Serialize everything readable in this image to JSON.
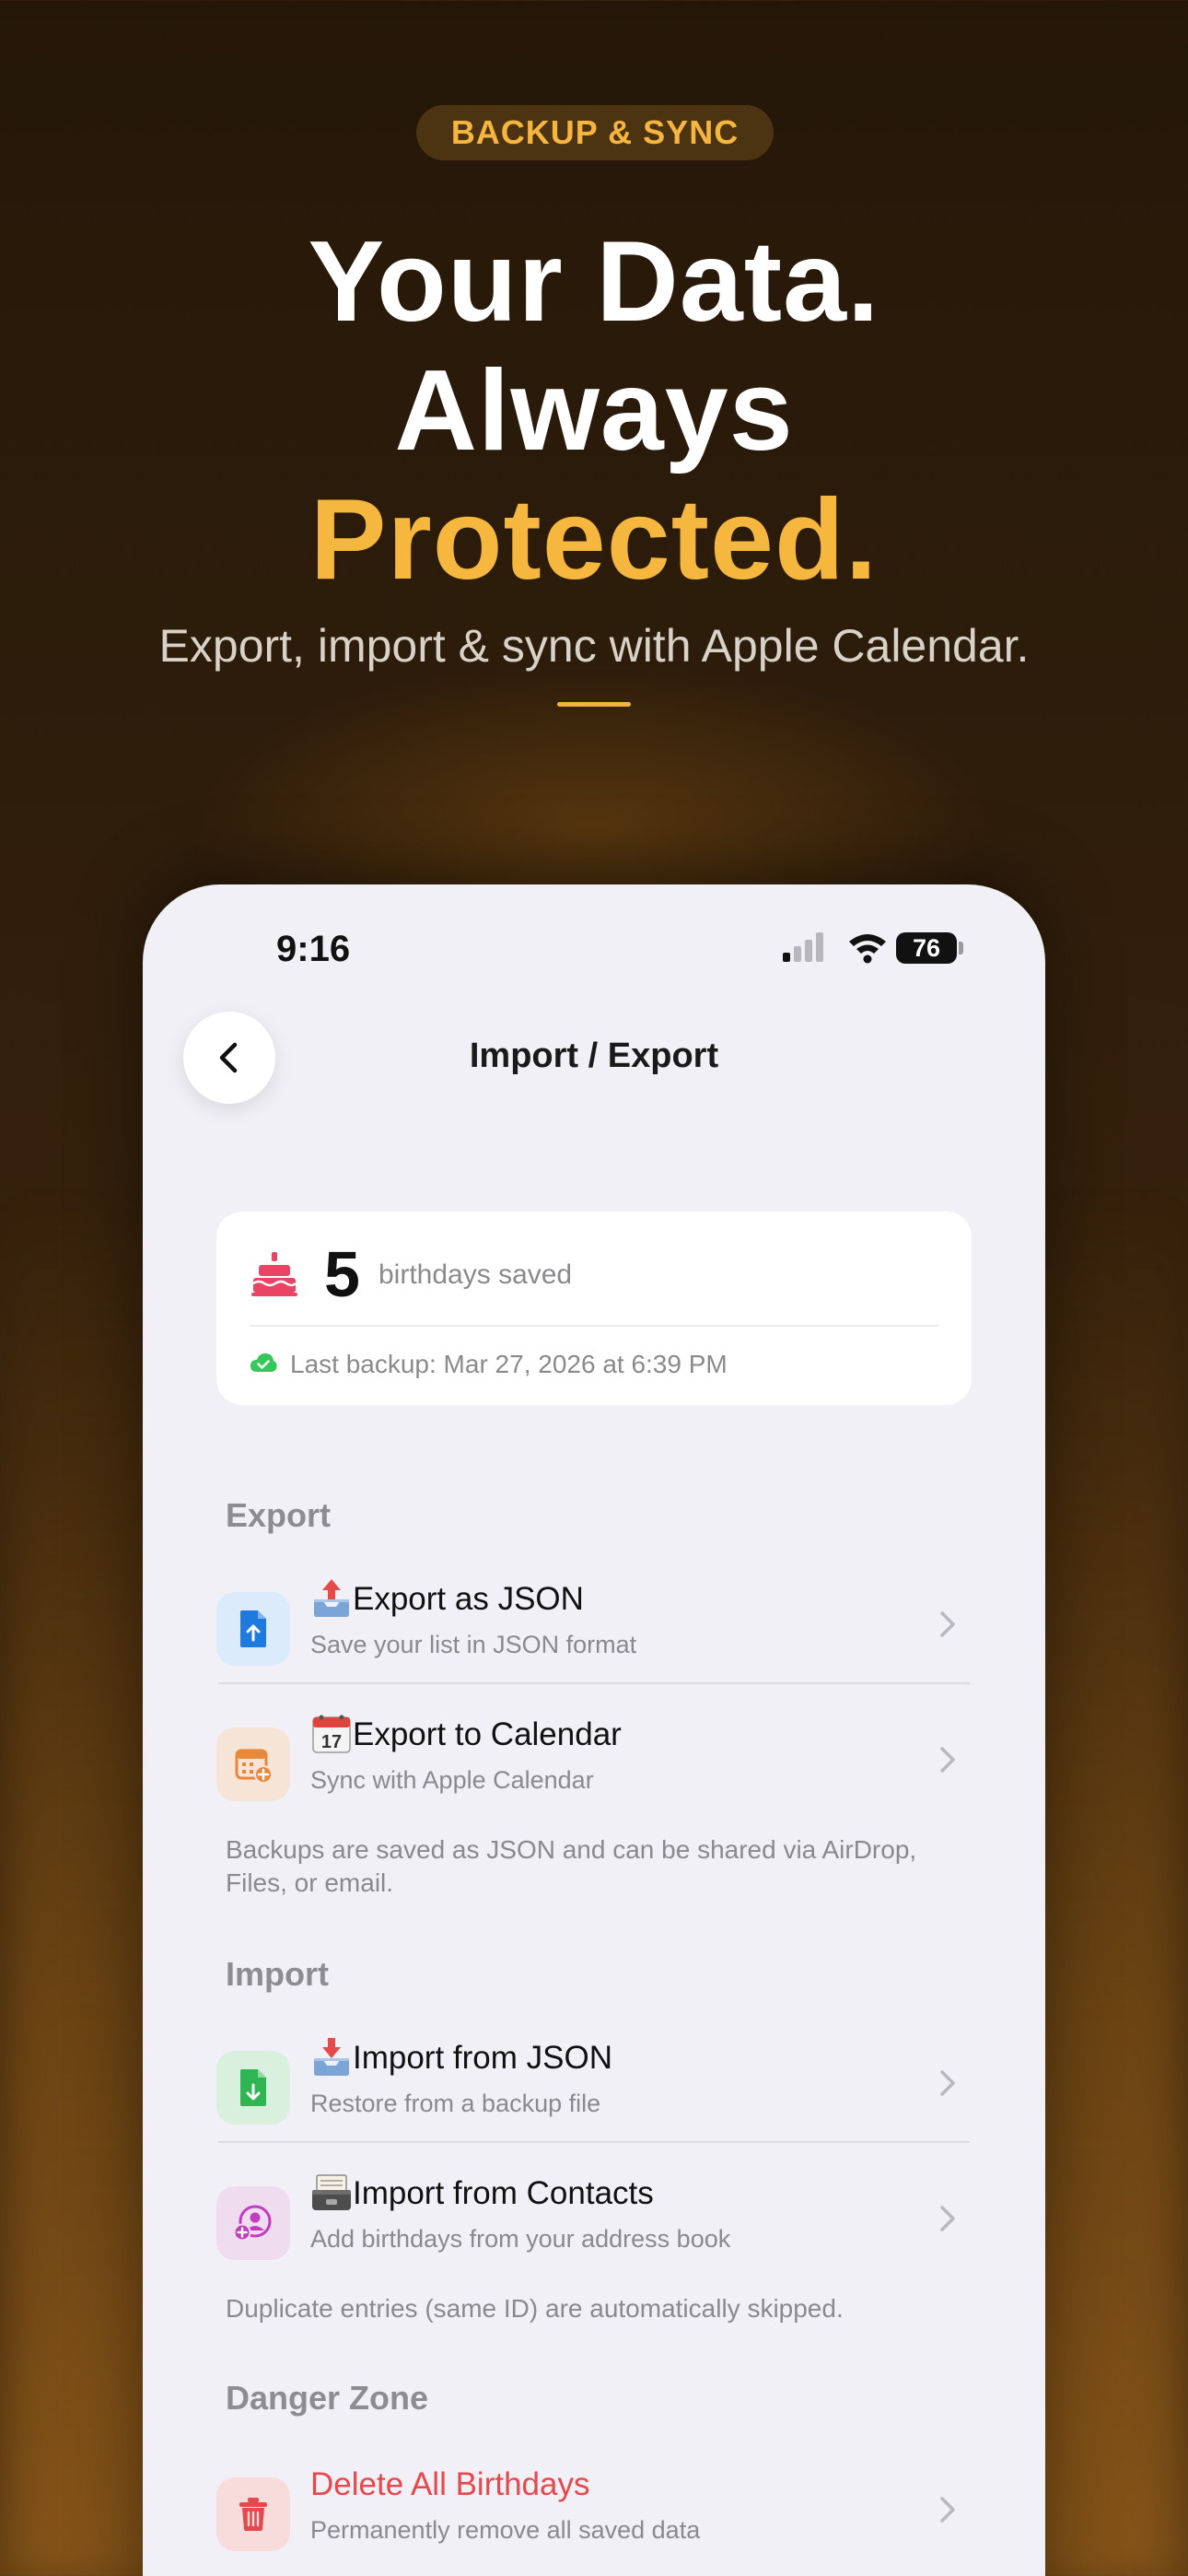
{
  "hero": {
    "badge": "BACKUP & SYNC",
    "line1": "Your Data.",
    "line2": "Always",
    "line3": "Protected.",
    "subtitle": "Export, import & sync with Apple Calendar."
  },
  "status_bar": {
    "time": "9:16",
    "battery": "76"
  },
  "nav": {
    "title": "Import / Export"
  },
  "summary": {
    "count": "5",
    "count_label": "birthdays saved",
    "last_backup": "Last backup: Mar 27, 2026 at 6:39 PM"
  },
  "export": {
    "header": "Export",
    "items": [
      {
        "title": "Export as JSON",
        "desc": "Save your list in JSON format"
      },
      {
        "title": "Export to Calendar",
        "desc": "Sync with Apple Calendar"
      }
    ],
    "footnote": "Backups are saved as JSON and can be shared via AirDrop, Files, or email."
  },
  "import": {
    "header": "Import",
    "items": [
      {
        "title": "Import from JSON",
        "desc": "Restore from a backup file"
      },
      {
        "title": "Import from Contacts",
        "desc": "Add birthdays from your address book"
      }
    ],
    "footnote": "Duplicate entries (same ID) are automatically skipped."
  },
  "danger": {
    "header": "Danger Zone",
    "items": [
      {
        "title": "Delete All Birthdays",
        "desc": "Permanently remove all saved data"
      }
    ]
  },
  "colors": {
    "accent": "#f6b73f",
    "danger": "#e5484d",
    "export_json_bg": "#dcebfb",
    "export_calendar_bg": "#f6e4d6",
    "import_json_bg": "#daf0df",
    "import_contacts_bg": "#f0dcef",
    "delete_bg": "#f8dcdc"
  },
  "icons": {
    "back": "chevron-left-icon",
    "cake": "birthday-cake-icon",
    "cloud": "cloud-check-icon",
    "export_json": "document-upload-icon",
    "export_calendar": "calendar-add-icon",
    "import_json": "document-download-icon",
    "import_contacts": "contact-add-icon",
    "delete": "trash-icon"
  }
}
